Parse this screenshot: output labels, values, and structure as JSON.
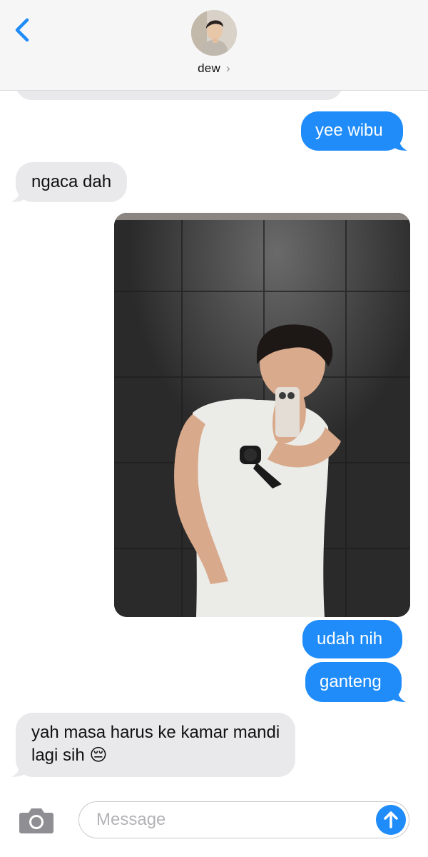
{
  "header": {
    "contact_name": "dew",
    "chevron": "›",
    "icons": {
      "back": "chevron-left-icon",
      "avatar": "contact-avatar"
    },
    "accent_color": "#1f8cfa"
  },
  "messages": [
    {
      "direction": "received",
      "text": "",
      "partial": true
    },
    {
      "direction": "sent",
      "text": "yee wibu"
    },
    {
      "direction": "received",
      "text": "ngaca dah"
    },
    {
      "direction": "received",
      "type": "photo"
    },
    {
      "direction": "sent",
      "text": "udah nih"
    },
    {
      "direction": "sent",
      "text": "ganteng"
    },
    {
      "direction": "received",
      "text_line1": "yah masa harus ke kamar mandi",
      "text_line2": "lagi sih",
      "emoji": "😔"
    }
  ],
  "composer": {
    "placeholder": "Message",
    "value": "",
    "icons": {
      "camera": "camera-icon",
      "send": "arrow-up-icon"
    }
  },
  "colors": {
    "sent_bubble": "#1f8cfa",
    "received_bubble": "#e9e9eb",
    "header_bg": "#f6f6f6"
  }
}
